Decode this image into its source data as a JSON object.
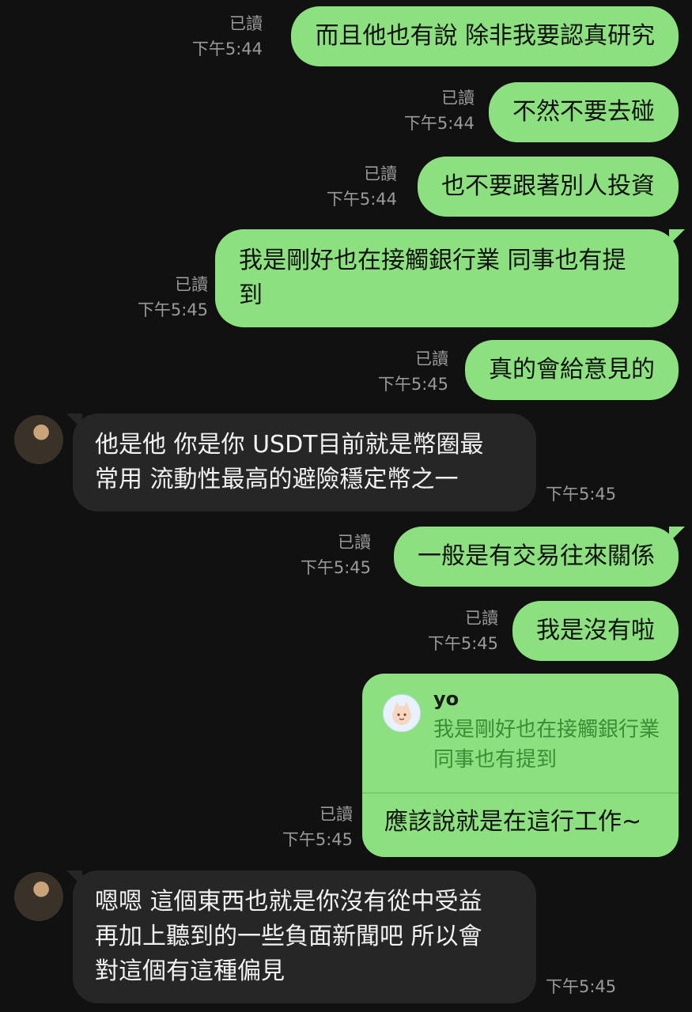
{
  "messages": [
    {
      "read": "已讀",
      "time": "下午5:44",
      "text": "而且他也有說 除非我要認真研究"
    },
    {
      "read": "已讀",
      "time": "下午5:44",
      "text": "不然不要去碰"
    },
    {
      "read": "已讀",
      "time": "下午5:44",
      "text": "也不要跟著別人投資"
    },
    {
      "read": "已讀",
      "time": "下午5:45",
      "text_line1": "我是剛好也在接觸銀行業 同事也有提",
      "text_line2": "到"
    },
    {
      "read": "已讀",
      "time": "下午5:45",
      "text": "真的會給意見的"
    },
    {
      "time": "下午5:45",
      "text_line1": "他是他 你是你 USDT目前就是幣圈最",
      "text_line2": "常用 流動性最高的避險穩定幣之一"
    },
    {
      "read": "已讀",
      "time": "下午5:45",
      "text": "一般是有交易往來關係"
    },
    {
      "read": "已讀",
      "time": "下午5:45",
      "text": "我是沒有啦"
    },
    {
      "read": "已讀",
      "time": "下午5:45",
      "quote_name": "yo",
      "quote_line1": "我是剛好也在接觸銀行業",
      "quote_line2": "同事也有提到",
      "text": "應該說就是在這行工作~"
    },
    {
      "time": "下午5:45",
      "text_line1": "嗯嗯 這個東西也就是你沒有從中受益",
      "text_line2": "再加上聽到的一些負面新聞吧 所以會",
      "text_line3": "對這個有這種偏見"
    }
  ],
  "colors": {
    "outgoing": "#8de07f",
    "incoming": "#262626",
    "background": "#111111",
    "meta": "#9a9a9a"
  }
}
